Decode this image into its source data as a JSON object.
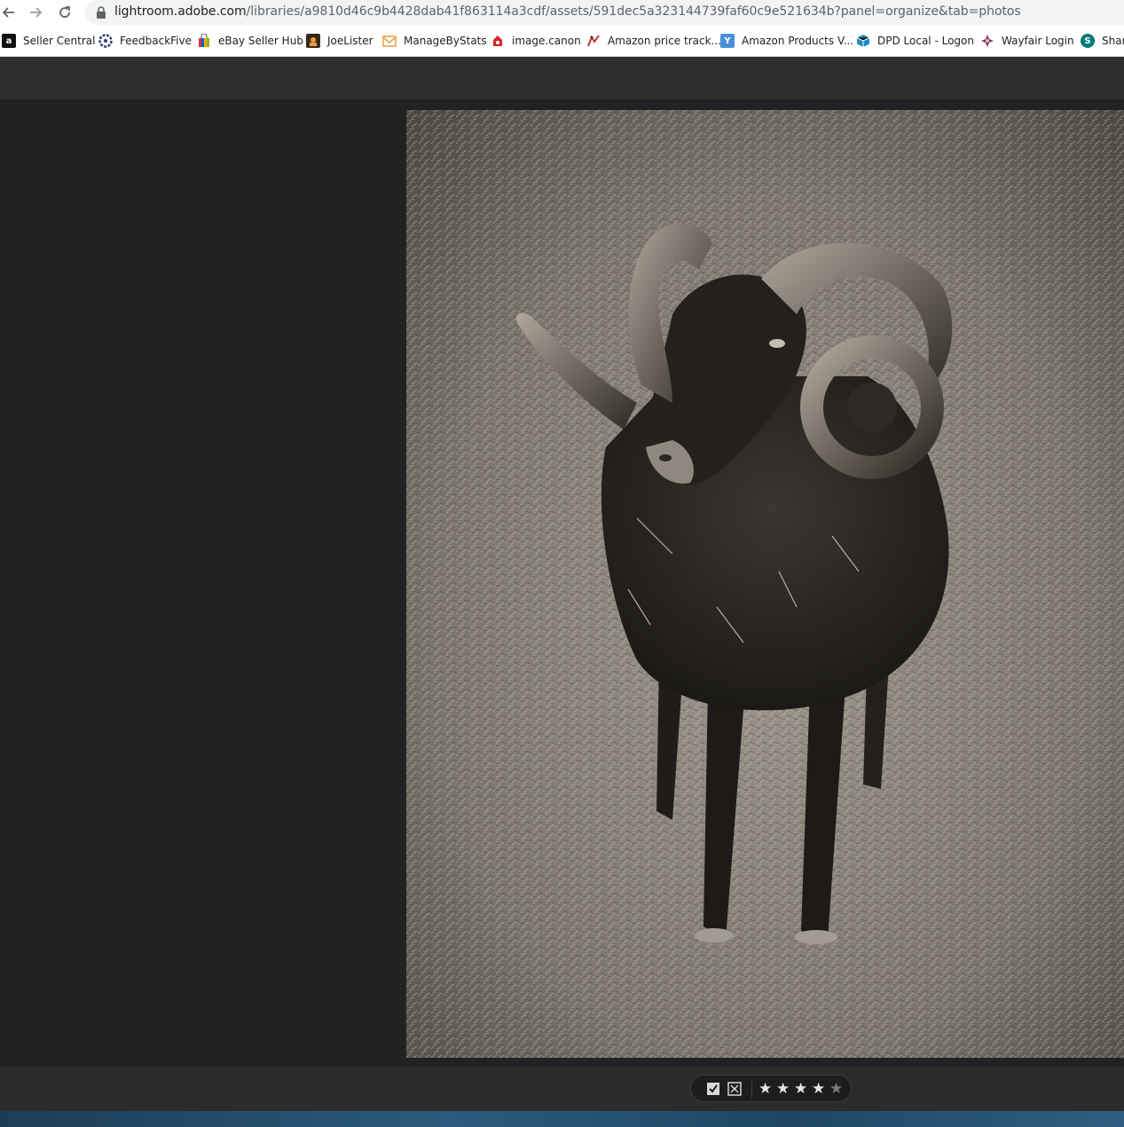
{
  "browser": {
    "url_host": "lightroom.adobe.com",
    "url_path": "/libraries/a9810d46c9b4428dab41f863114a3cdf/assets/591dec5a323144739faf60c9e521634b?panel=organize&tab=photos",
    "icons": [
      "back-arrow-icon",
      "forward-arrow-icon",
      "reload-icon",
      "lock-icon"
    ]
  },
  "bookmarks": [
    {
      "label": "Seller Central",
      "icon": "amazon-icon"
    },
    {
      "label": "FeedbackFive",
      "icon": "feedbackfive-icon"
    },
    {
      "label": "eBay Seller Hub",
      "icon": "ebay-bag-icon"
    },
    {
      "label": "JoeLister",
      "icon": "joelister-icon"
    },
    {
      "label": "ManageByStats",
      "icon": "managebystats-icon"
    },
    {
      "label": "image.canon",
      "icon": "canon-icon"
    },
    {
      "label": "Amazon price track...",
      "icon": "price-tracker-icon"
    },
    {
      "label": "Amazon Products V...",
      "icon": "amazon-products-icon"
    },
    {
      "label": "DPD Local - Logon",
      "icon": "dpd-cube-icon"
    },
    {
      "label": "Wayfair Login",
      "icon": "wayfair-icon"
    },
    {
      "label": "Share",
      "icon": "sharepoint-icon"
    }
  ],
  "viewer": {
    "photo_subject": "black horned ram standing on grass, sepia toned",
    "rating": {
      "stars_filled": 4,
      "stars_total": 5
    },
    "flags": [
      "pick-flag-icon",
      "reject-flag-icon"
    ]
  },
  "colors": {
    "app_background": "#222222",
    "header_background": "#2d2d2d",
    "bottom_bar_background": "#2c2c2c",
    "star_active": "#e6e6e6",
    "star_inactive": "#7a7a7a"
  }
}
